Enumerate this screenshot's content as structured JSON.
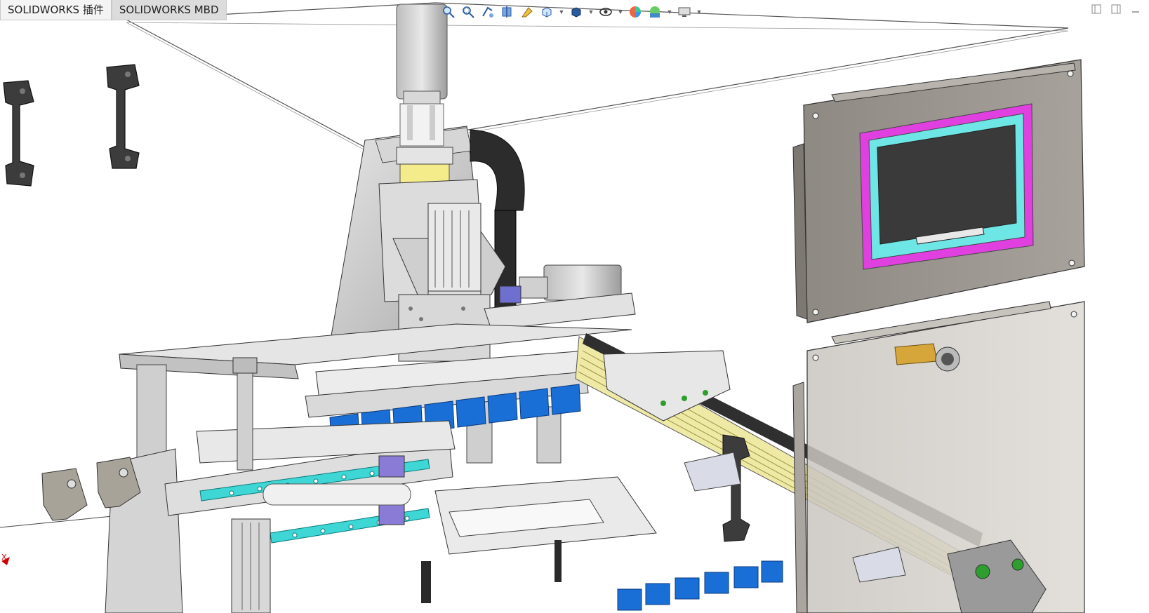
{
  "tabs": [
    {
      "label": "SOLIDWORKS 插件",
      "active": false
    },
    {
      "label": "SOLIDWORKS MBD",
      "active": true
    }
  ],
  "heads_up_toolbar": [
    {
      "icon": "zoom-to-fit-icon"
    },
    {
      "icon": "zoom-to-area-icon"
    },
    {
      "icon": "previous-view-icon"
    },
    {
      "icon": "section-view-icon"
    },
    {
      "icon": "dynamic-annotation-icon"
    },
    {
      "icon": "view-orientation-icon"
    },
    {
      "icon": "display-style-icon"
    },
    {
      "icon": "hide-show-items-icon"
    },
    {
      "icon": "edit-appearance-icon"
    },
    {
      "icon": "apply-scene-icon"
    },
    {
      "icon": "view-settings-icon"
    }
  ],
  "window_controls": [
    "tile-left-icon",
    "tile-right-icon",
    "minimize-icon"
  ],
  "triad": {
    "axis_label": "X"
  },
  "colors": {
    "frame_gray": "#bdbdbd",
    "plate_gray": "#9a958e",
    "screen_magenta": "#e040e0",
    "screen_cyan": "#6fe6e6",
    "screen_dark": "#3a3a3a",
    "blue_blocks": "#1a6fd6",
    "rail_yellow": "#e6e07a",
    "handle_dark": "#3c3c3c"
  }
}
